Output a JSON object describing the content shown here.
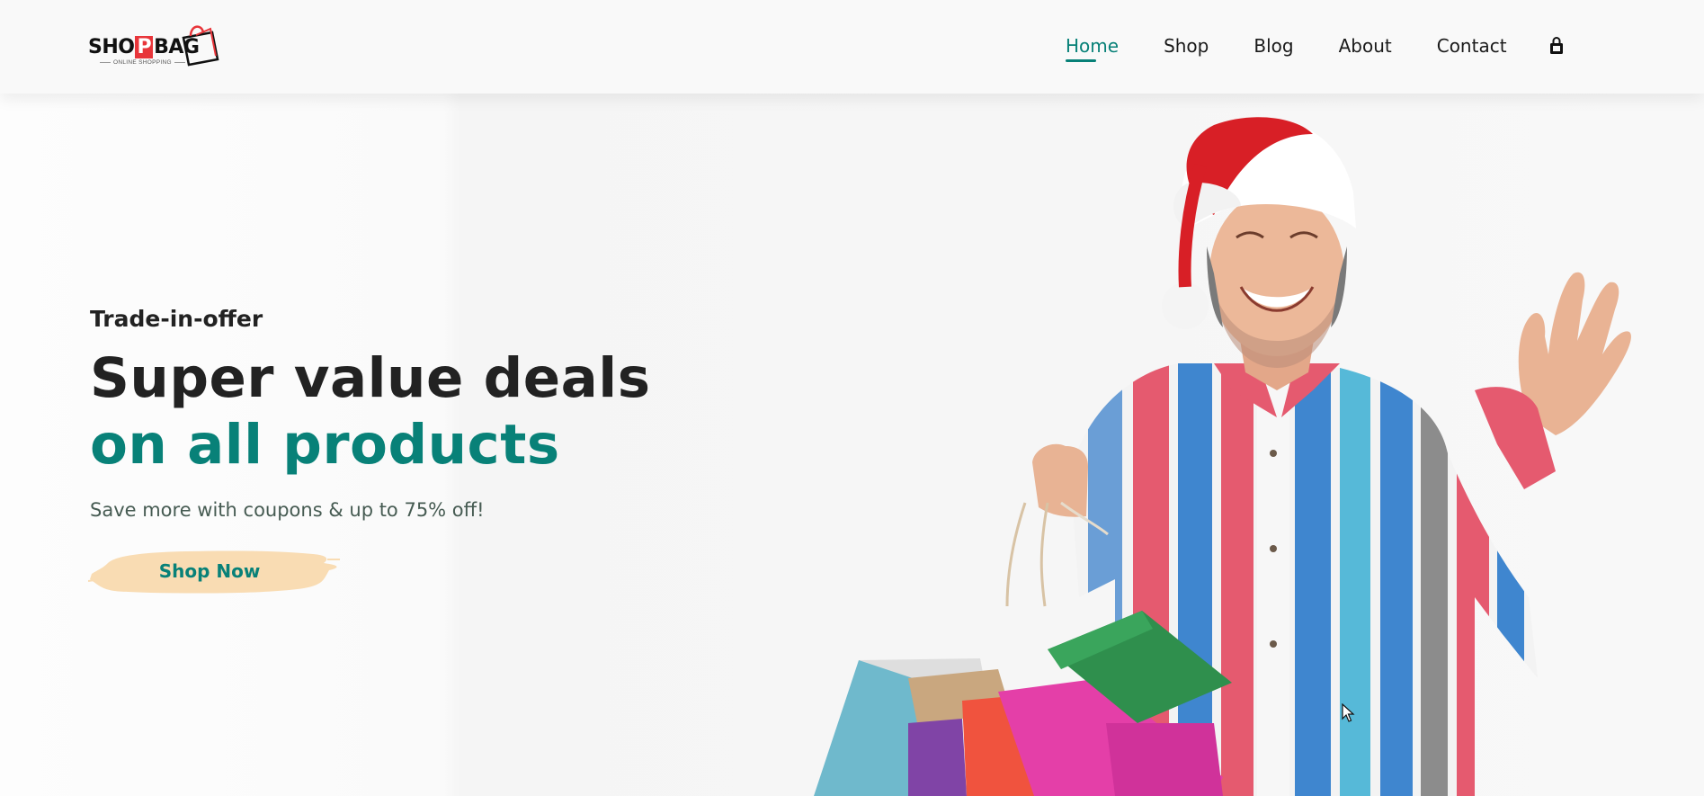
{
  "header": {
    "logo": {
      "word_left": "SHO",
      "word_p": "P",
      "word_right": "BAG",
      "tagline": "ONLINE SHOPPING"
    },
    "nav": [
      {
        "label": "Home",
        "active": true
      },
      {
        "label": "Shop",
        "active": false
      },
      {
        "label": "Blog",
        "active": false
      },
      {
        "label": "About",
        "active": false
      },
      {
        "label": "Contact",
        "active": false
      }
    ],
    "cart_icon": "shopping-bag-icon"
  },
  "hero": {
    "kicker": "Trade-in-offer",
    "headline_line1": "Super value deals",
    "headline_line2": "on all products",
    "subtext": "Save more with coupons & up to 75% off!",
    "cta_label": "Shop Now",
    "image_alt": "Smiling man in santa hat holding colorful shopping bags"
  },
  "colors": {
    "accent": "#088178",
    "brush": "#f9dcb3",
    "text_dark": "#222222",
    "logo_red": "#e8353a"
  }
}
